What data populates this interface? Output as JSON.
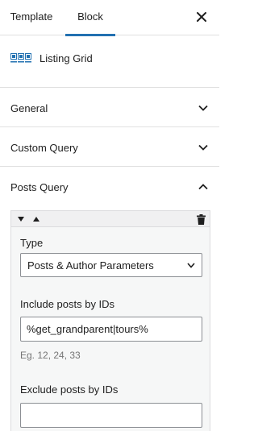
{
  "tabs": {
    "template_label": "Template",
    "block_label": "Block",
    "active": "Block"
  },
  "block_card": {
    "title": "Listing Grid",
    "icon": "listing-grid-icon",
    "icon_color": "#2271b1"
  },
  "panels": [
    {
      "title": "General",
      "expanded": false
    },
    {
      "title": "Custom Query",
      "expanded": false
    },
    {
      "title": "Posts Query",
      "expanded": true
    }
  ],
  "posts_query": {
    "type_label": "Type",
    "type_value": "Posts & Author Parameters",
    "include_label": "Include posts by IDs",
    "include_value": "%get_grandparent|tours%",
    "include_hint": "Eg. 12, 24, 33",
    "exclude_label": "Exclude posts by IDs",
    "exclude_value": ""
  },
  "colors": {
    "accent": "#2271b1",
    "border": "#e0e0e0",
    "text": "#1e1e1e",
    "muted": "#757575"
  }
}
